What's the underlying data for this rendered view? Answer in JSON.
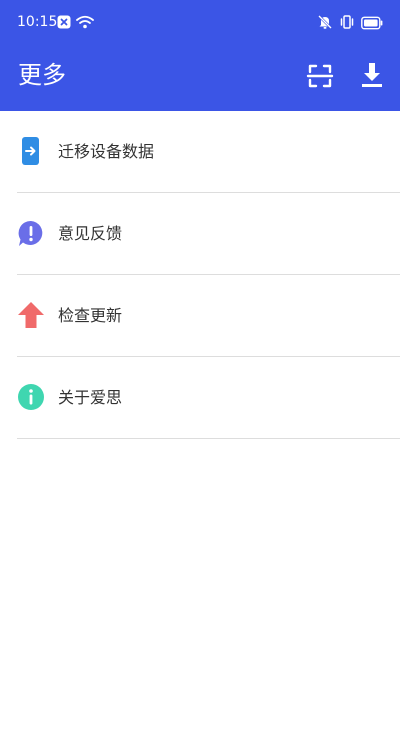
{
  "status_bar": {
    "time": "10:15"
  },
  "header": {
    "title": "更多",
    "scan_icon": "scan-icon",
    "download_icon": "download-icon"
  },
  "colors": {
    "primary": "#3b55e6",
    "migrate": "#2f8de4",
    "feedback": "#6a6ee8",
    "update": "#f06a6a",
    "about": "#3fd6b0",
    "divider": "#dddddd"
  },
  "menu": {
    "items": [
      {
        "label": "迁移设备数据",
        "icon": "migrate-data-icon"
      },
      {
        "label": "意见反馈",
        "icon": "feedback-icon"
      },
      {
        "label": "检查更新",
        "icon": "update-arrow-icon"
      },
      {
        "label": "关于爱思",
        "icon": "info-icon"
      }
    ]
  }
}
